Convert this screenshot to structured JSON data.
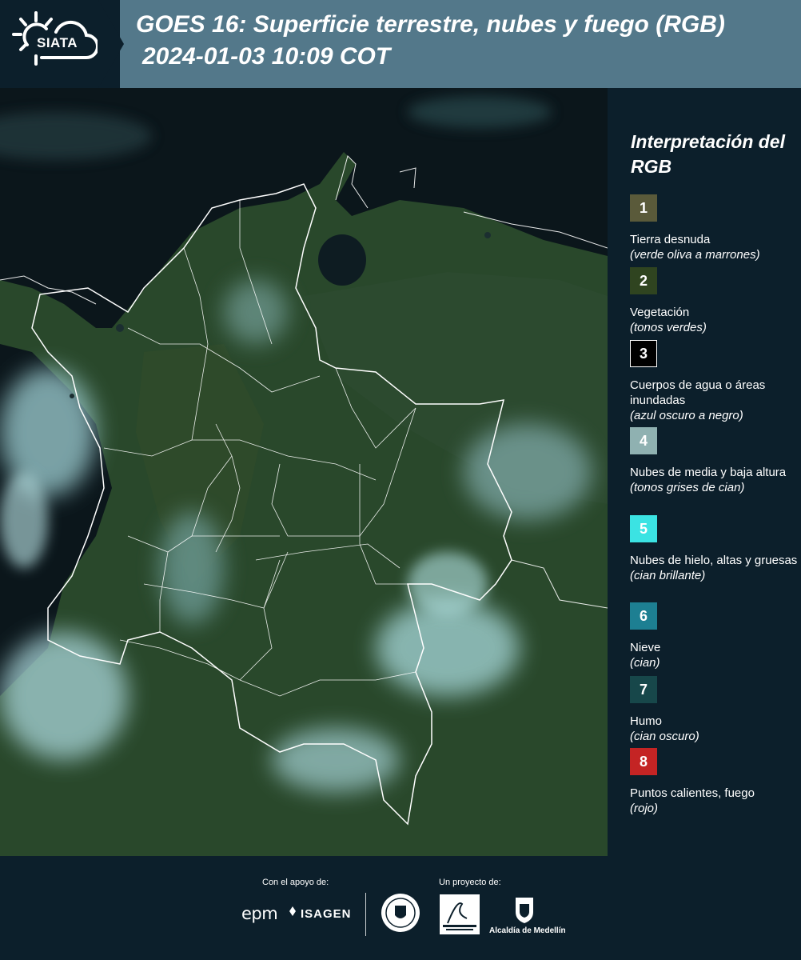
{
  "header": {
    "logo_text": "SIATA",
    "title_line1": "GOES 16: Superficie terrestre, nubes y fuego (RGB)",
    "title_line2": "2024-01-03 10:09 COT"
  },
  "legend": {
    "title": "Interpretación del RGB",
    "items": [
      {
        "number": "1",
        "label": "Tierra desnuda",
        "note": "(verde oliva a marrones)",
        "color": "#5a5a3a"
      },
      {
        "number": "2",
        "label": "Vegetación",
        "note": "(tonos verdes)",
        "color": "#2f4420"
      },
      {
        "number": "3",
        "label": "Cuerpos de agua o áreas inundadas",
        "note": "(azul oscuro a negro)",
        "color": "#000000"
      },
      {
        "number": "4",
        "label": "Nubes de media y baja altura",
        "note": "(tonos grises de cian)",
        "color": "#8fb1b1"
      },
      {
        "number": "5",
        "label": "Nubes de hielo, altas y gruesas",
        "note": "(cian brillante)",
        "color": "#3be3e3"
      },
      {
        "number": "6",
        "label": "Nieve",
        "note": "(cian)",
        "color": "#1d7f92"
      },
      {
        "number": "7",
        "label": "Humo",
        "note": "(cian oscuro)",
        "color": "#17474a"
      },
      {
        "number": "8",
        "label": "Puntos calientes, fuego",
        "note": "(rojo)",
        "color": "#c42424"
      }
    ]
  },
  "footer": {
    "support_label": "Con el apoyo de:",
    "project_label": "Un proyecto de:",
    "epm": "epm",
    "isagen": "ISAGEN",
    "alcaldia": "Alcaldía de Medellín"
  }
}
